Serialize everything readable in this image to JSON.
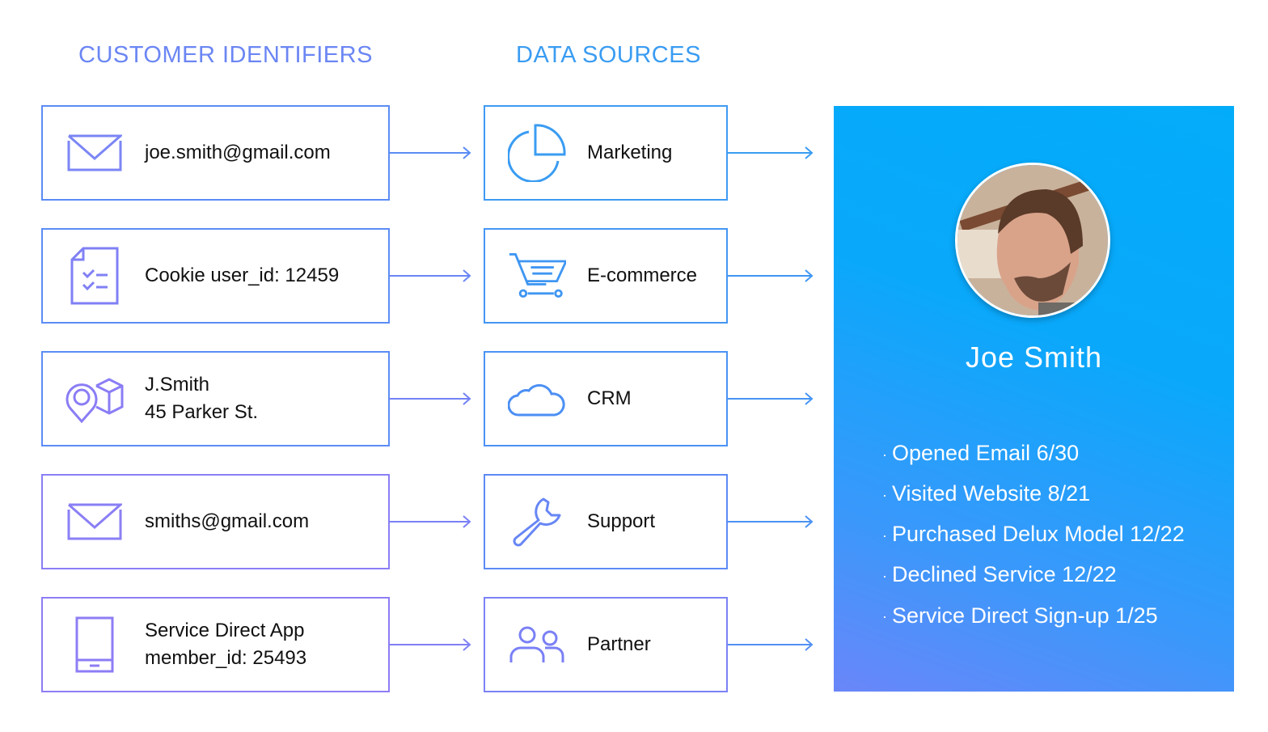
{
  "headings": {
    "identifiers": "CUSTOMER IDENTIFIERS",
    "sources": "DATA SOURCES"
  },
  "identifiers": [
    {
      "icon": "envelope-icon",
      "lines": [
        "joe.smith@gmail.com"
      ]
    },
    {
      "icon": "checklist-document-icon",
      "lines": [
        "Cookie user_id: 12459"
      ]
    },
    {
      "icon": "location-package-icon",
      "lines": [
        "J.Smith",
        "45 Parker St."
      ]
    },
    {
      "icon": "envelope-icon",
      "lines": [
        "smiths@gmail.com"
      ]
    },
    {
      "icon": "mobile-phone-icon",
      "lines": [
        "Service Direct App",
        "member_id: 25493"
      ]
    }
  ],
  "sources": [
    {
      "icon": "pie-chart-icon",
      "label": "Marketing"
    },
    {
      "icon": "shopping-cart-icon",
      "label": "E-commerce"
    },
    {
      "icon": "cloud-icon",
      "label": "CRM"
    },
    {
      "icon": "wrench-icon",
      "label": "Support"
    },
    {
      "icon": "users-icon",
      "label": "Partner"
    }
  ],
  "profile": {
    "name": "Joe Smith",
    "bullet": "·",
    "events": [
      "Opened Email 6/30",
      "Visited Website 8/21",
      "Purchased Delux Model 12/22",
      "Declined Service 12/22",
      "Service Direct Sign-up 1/25"
    ]
  },
  "colors": {
    "identifier_accent": "#7b7ff5",
    "source_accent": "#3a9cf2",
    "profile_gradient_top": "#03acf9",
    "profile_gradient_bottom": "#6a86f9"
  }
}
